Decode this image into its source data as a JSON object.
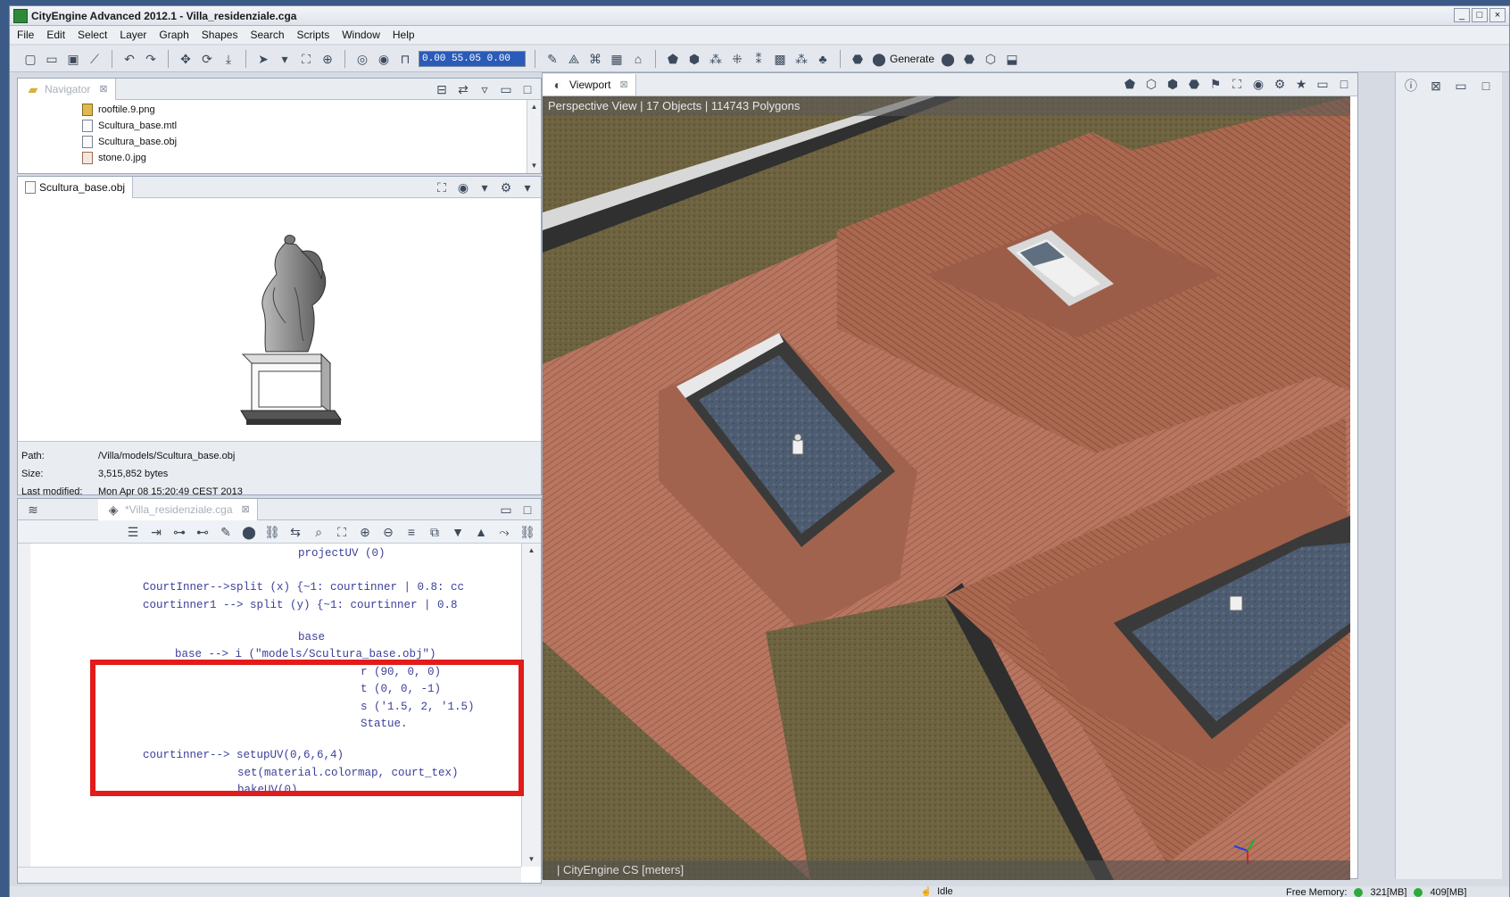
{
  "window": {
    "title": "CityEngine Advanced 2012.1 - Villa_residenziale.cga",
    "controls": [
      "_",
      "□",
      "×"
    ]
  },
  "menu": [
    "File",
    "Edit",
    "Select",
    "Layer",
    "Graph",
    "Shapes",
    "Search",
    "Scripts",
    "Window",
    "Help"
  ],
  "toolbar": {
    "coord_value": "0.00 55.05 0.00",
    "generate_label": "Generate"
  },
  "navigator": {
    "tab_label": "Navigator",
    "files": [
      {
        "name": "rooftile.9.png",
        "type": "png"
      },
      {
        "name": "Scultura_base.mtl",
        "type": "mtl"
      },
      {
        "name": "Scultura_base.obj",
        "type": "obj"
      },
      {
        "name": "stone.0.jpg",
        "type": "jpg"
      }
    ]
  },
  "preview": {
    "tab_label": "Scultura_base.obj",
    "info": {
      "path_label": "Path:",
      "path_value": "/Villa/models/Scultura_base.obj",
      "size_label": "Size:",
      "size_value": "3,515,852 bytes",
      "modified_label": "Last modified:",
      "modified_value": "Mon Apr 08 15:20:49 CEST 2013"
    }
  },
  "editor": {
    "tab_label": "*Villa_residenziale.cga",
    "lines": [
      "projectUV (0)",
      "CourtInner-->split (x) {~1: courtinner | 0.8: cc",
      "courtinner1 --> split (y) {~1: courtinner | 0.8",
      "base",
      "base --> i (\"models/Scultura_base.obj\")",
      "r (90, 0, 0)",
      "t (0, 0, -1)",
      "s ('1.5, 2, '1.5)",
      "Statue.",
      "courtinner--> setupUV(0,6,6,4)",
      "set(material.colormap, court_tex)",
      "bakeUV(0)"
    ]
  },
  "viewport": {
    "tab_label": "Viewport",
    "header": "Perspective View  |  17 Objects  |  114743 Polygons",
    "footer": "|  CityEngine CS [meters]"
  },
  "status": {
    "text": "Idle",
    "free_memory_label": "Free Memory:",
    "memory_value": "321[MB]",
    "memory_value2": "409[MB]"
  },
  "colors": {
    "highlight_border": "#e21b1b",
    "roof": "#b67560",
    "grass": "#6b6140",
    "court": "#4a5a70"
  }
}
